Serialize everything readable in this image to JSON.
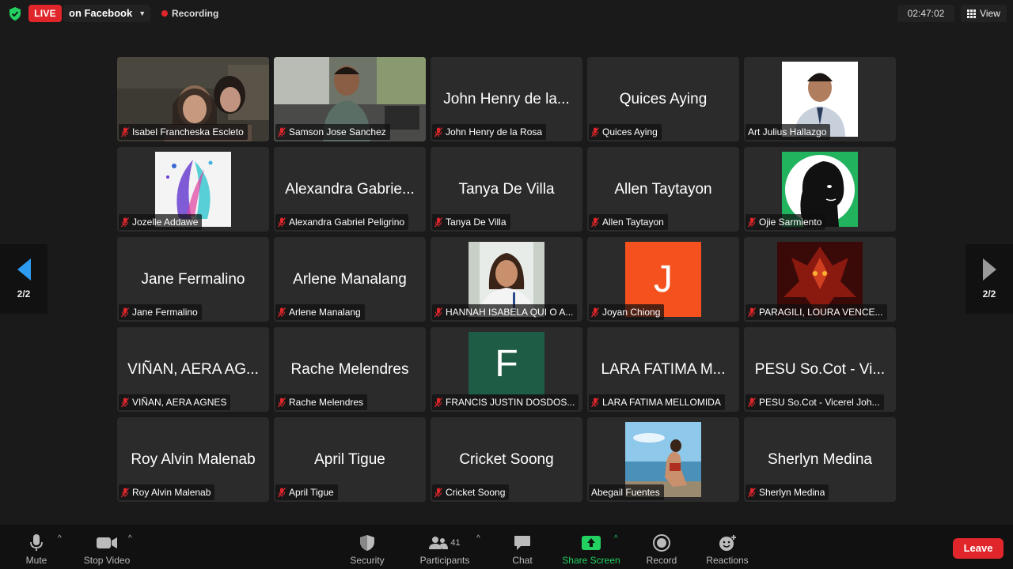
{
  "topbar": {
    "live_label": "LIVE",
    "live_destination": "on Facebook",
    "recording_label": "Recording",
    "clock": "02:47:02",
    "view_label": "View"
  },
  "pagination": {
    "left_page": "2/2",
    "right_page": "2/2"
  },
  "colors": {
    "live_red": "#e0262b",
    "share_green": "#23d160",
    "nav_blue": "#2d9cf0",
    "shield_green": "#23d160"
  },
  "participants": [
    {
      "label": "Isabel Francheska Escleto",
      "display": ""
    },
    {
      "label": "Samson Jose Sanchez",
      "display": ""
    },
    {
      "label": "John Henry de la Rosa",
      "display": "John Henry de la..."
    },
    {
      "label": "Quices Aying",
      "display": "Quices Aying"
    },
    {
      "label": "Art Julius Hallazgo",
      "display": ""
    },
    {
      "label": "Jozelle Addawe",
      "display": ""
    },
    {
      "label": "Alexandra Gabriel Peligrino",
      "display": "Alexandra Gabrie..."
    },
    {
      "label": "Tanya De Villa",
      "display": "Tanya De Villa"
    },
    {
      "label": "Allen Taytayon",
      "display": "Allen Taytayon"
    },
    {
      "label": "Ojie Sarmiento",
      "display": ""
    },
    {
      "label": "Jane Fermalino",
      "display": "Jane Fermalino"
    },
    {
      "label": "Arlene Manalang",
      "display": "Arlene Manalang"
    },
    {
      "label": "HANNAH ISABELA QUI O A...",
      "display": ""
    },
    {
      "label": "Joyan Chiong",
      "display": "",
      "initial": "J"
    },
    {
      "label": "PARAGILI, LOURA VENCE...",
      "display": ""
    },
    {
      "label": "VIÑAN, AERA AGNES",
      "display": "VIÑAN, AERA AG..."
    },
    {
      "label": "Rache Melendres",
      "display": "Rache Melendres"
    },
    {
      "label": "FRANCIS JUSTIN DOSDOS...",
      "display": "",
      "initial": "F"
    },
    {
      "label": "LARA FATIMA MELLOMIDA",
      "display": "LARA FATIMA M..."
    },
    {
      "label": "PESU So.Cot - Vicerel Joh...",
      "display": "PESU So.Cot - Vi..."
    },
    {
      "label": "Roy Alvin Malenab",
      "display": "Roy Alvin Malenab"
    },
    {
      "label": "April Tigue",
      "display": "April Tigue"
    },
    {
      "label": "Cricket Soong",
      "display": "Cricket Soong"
    },
    {
      "label": "Abegail Fuentes",
      "display": ""
    },
    {
      "label": "Sherlyn Medina",
      "display": "Sherlyn Medina"
    }
  ],
  "toolbar": {
    "mute": "Mute",
    "stop_video": "Stop Video",
    "security": "Security",
    "participants": "Participants",
    "participants_count": "41",
    "chat": "Chat",
    "share_screen": "Share Screen",
    "record": "Record",
    "reactions": "Reactions",
    "leave": "Leave"
  }
}
